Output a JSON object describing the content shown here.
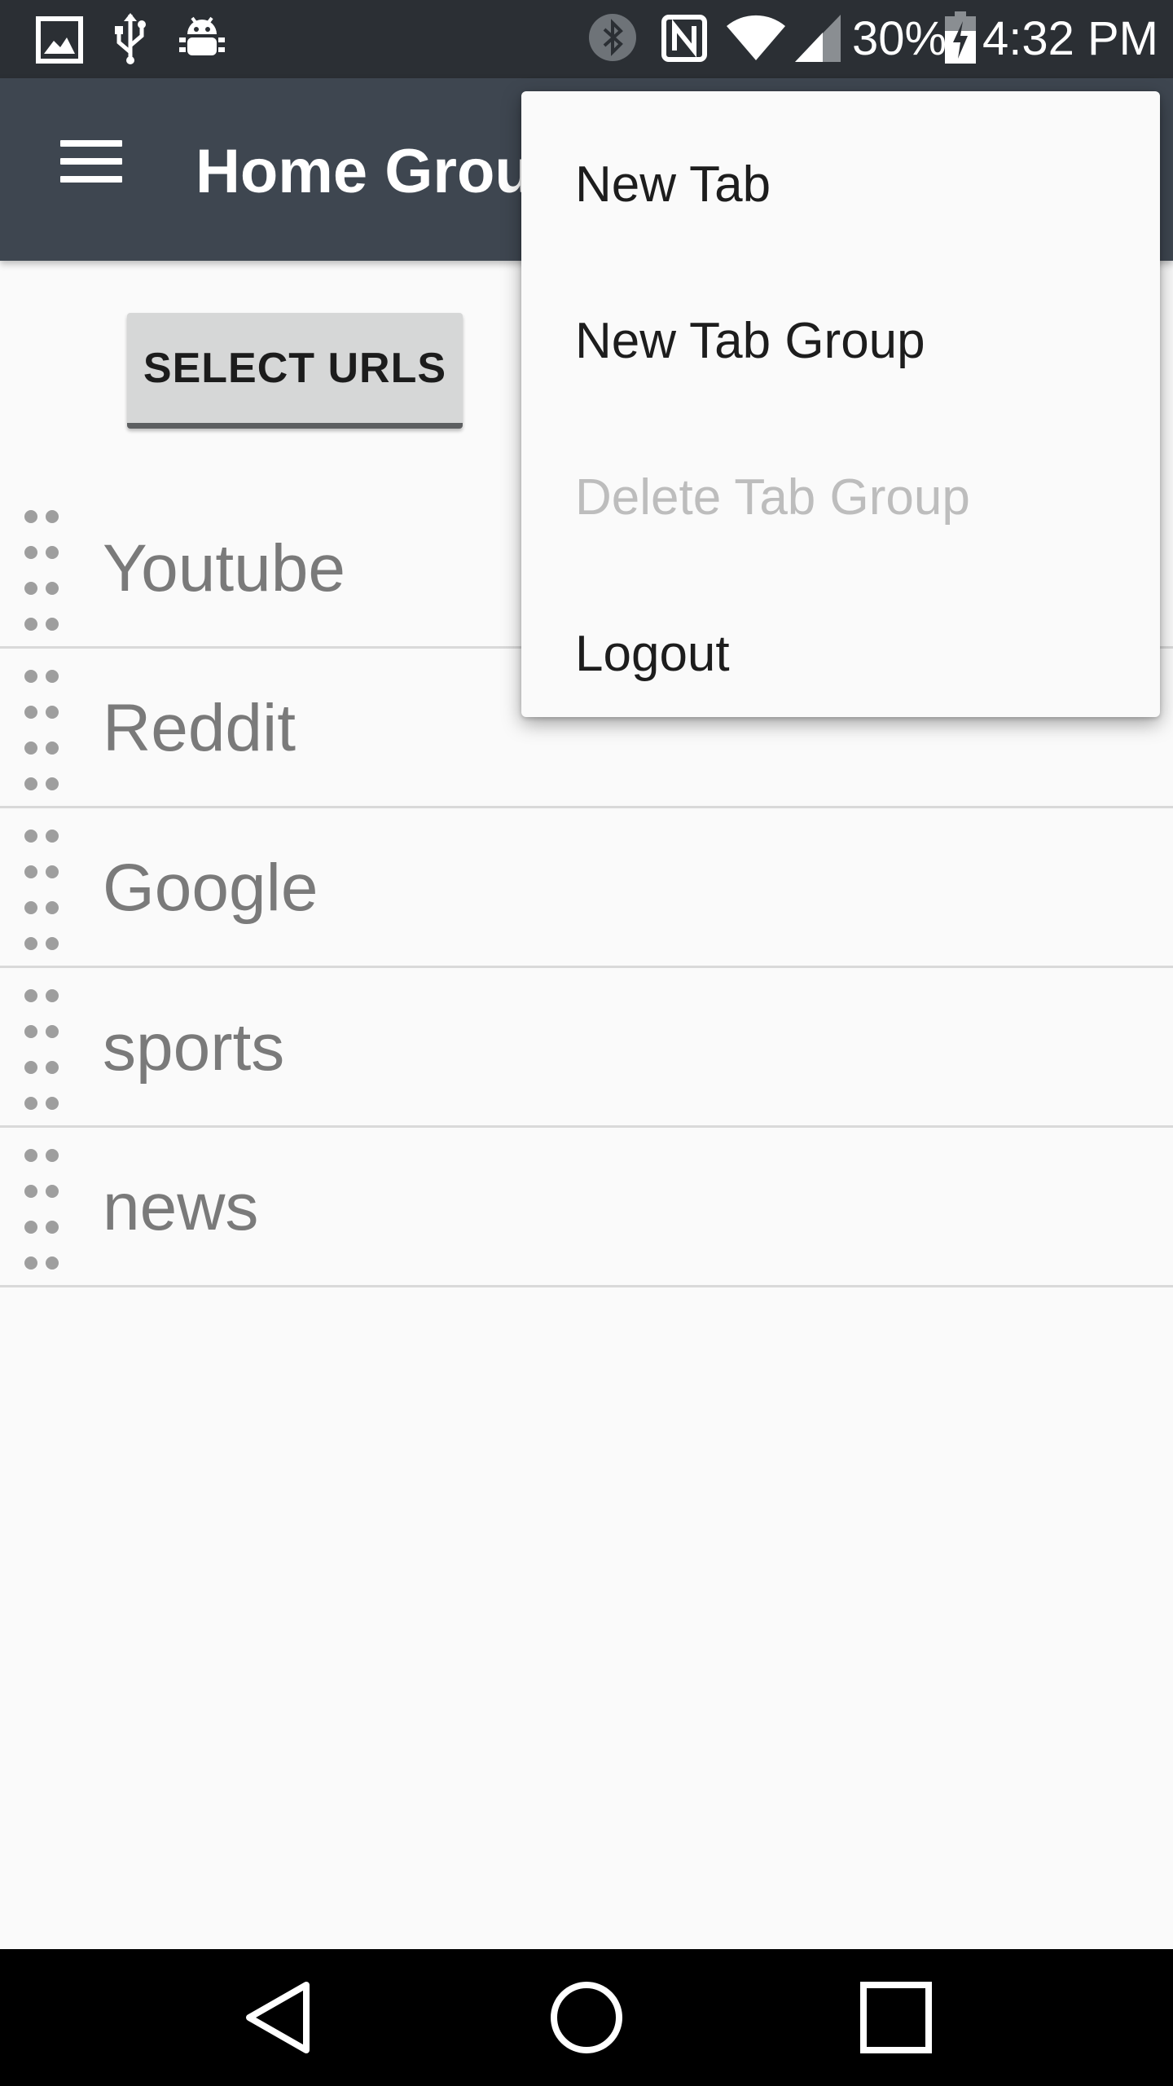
{
  "status_bar": {
    "battery": "30%",
    "time": "4:32 PM",
    "icons": [
      "gallery-icon",
      "usb-icon",
      "android-debug-icon",
      "bluetooth-icon",
      "nfc-icon",
      "wifi-icon",
      "signal-icon",
      "battery-charging-icon"
    ]
  },
  "app_bar": {
    "title": "Home Group",
    "menu_icon": "hamburger-menu-icon"
  },
  "content": {
    "select_button": "SELECT URLS",
    "items": [
      {
        "label": "Youtube"
      },
      {
        "label": "Reddit"
      },
      {
        "label": "Google"
      },
      {
        "label": "sports"
      },
      {
        "label": "news"
      }
    ]
  },
  "overflow_menu": {
    "items": [
      {
        "label": "New Tab",
        "enabled": true
      },
      {
        "label": "New Tab Group",
        "enabled": true
      },
      {
        "label": "Delete Tab Group",
        "enabled": false
      },
      {
        "label": "Logout",
        "enabled": true
      }
    ]
  },
  "nav_bar": {
    "icons": [
      "back-icon",
      "home-icon",
      "recents-icon"
    ]
  },
  "colors": {
    "status_bar": "#2b2f34",
    "app_bar": "#3e4650",
    "background": "#fafafa",
    "disabled_text": "#bdbdbd"
  }
}
